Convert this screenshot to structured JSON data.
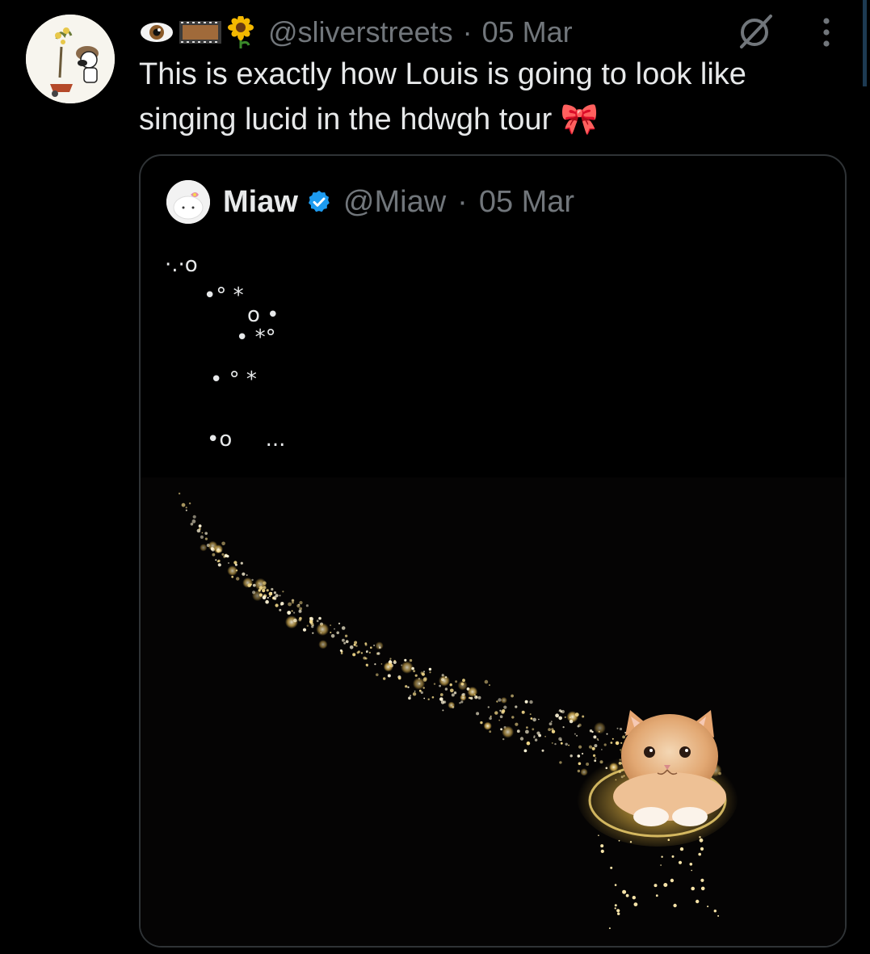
{
  "tweet": {
    "handle": "@sliverstreets",
    "separator": "·",
    "date": "05 Mar",
    "text": "This is exactly how  Louis is going to look like singing lucid in the hdwgh tour 🎀",
    "display_emojis": [
      "eye-emoji",
      "film-strip-emoji",
      "sunflower-emoji"
    ]
  },
  "quote": {
    "name": "Miaw",
    "handle": "@Miaw",
    "separator": "·",
    "date": "05 Mar",
    "verified": true,
    "text_lines": [
      "·.·o",
      "•° *",
      "o •",
      "• *°",
      "• ° *",
      "•o     ..."
    ],
    "image": {
      "description_icon": "kitten-sparkle-trail-image"
    }
  },
  "colors": {
    "background": "#000000",
    "text_primary": "#e7e9ea",
    "text_secondary": "#71767b",
    "border": "#2f3336",
    "verified_blue": "#1d9bf0"
  }
}
